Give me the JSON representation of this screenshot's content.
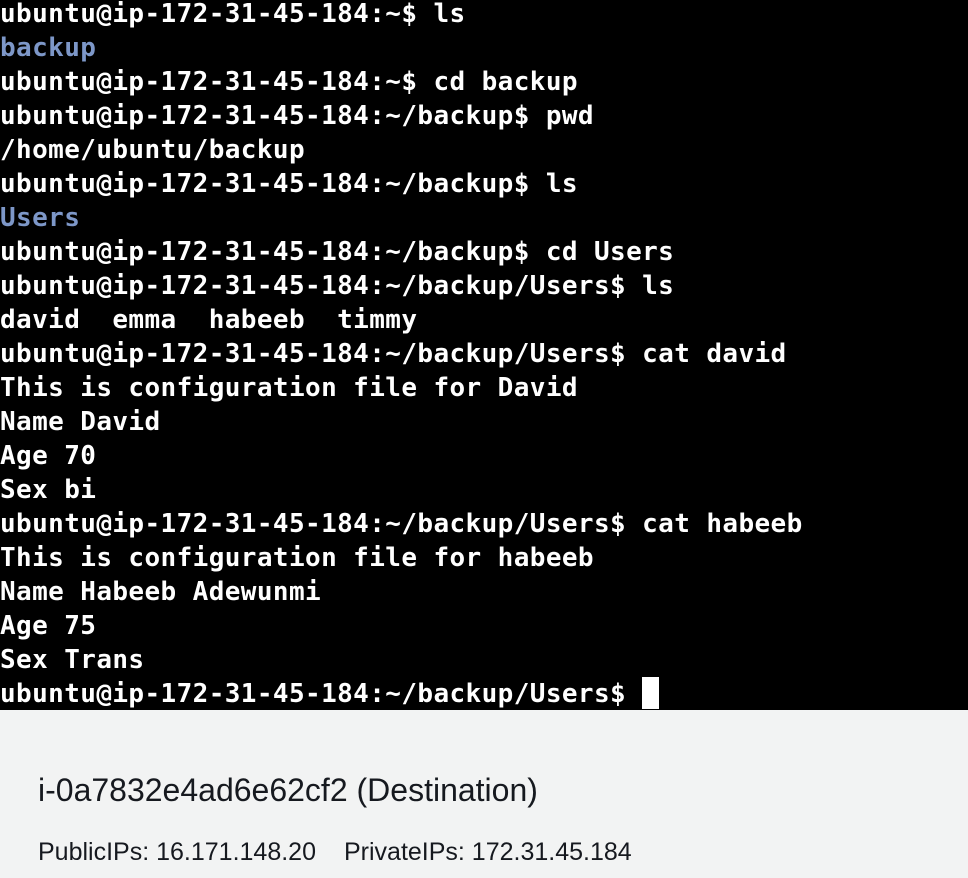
{
  "terminal": {
    "lines": [
      {
        "text": "ubuntu@ip-172-31-45-184:~$ ls",
        "kind": "prompt"
      },
      {
        "text": "backup",
        "kind": "dir"
      },
      {
        "text": "ubuntu@ip-172-31-45-184:~$ cd backup",
        "kind": "prompt"
      },
      {
        "text": "ubuntu@ip-172-31-45-184:~/backup$ pwd",
        "kind": "prompt"
      },
      {
        "text": "/home/ubuntu/backup",
        "kind": "output"
      },
      {
        "text": "ubuntu@ip-172-31-45-184:~/backup$ ls",
        "kind": "prompt"
      },
      {
        "text": "Users",
        "kind": "dir"
      },
      {
        "text": "ubuntu@ip-172-31-45-184:~/backup$ cd Users",
        "kind": "prompt"
      },
      {
        "text": "ubuntu@ip-172-31-45-184:~/backup/Users$ ls",
        "kind": "prompt"
      },
      {
        "text": "david  emma  habeeb  timmy",
        "kind": "output"
      },
      {
        "text": "ubuntu@ip-172-31-45-184:~/backup/Users$ cat david",
        "kind": "prompt"
      },
      {
        "text": "This is configuration file for David",
        "kind": "output"
      },
      {
        "text": "Name David",
        "kind": "output"
      },
      {
        "text": "Age 70",
        "kind": "output"
      },
      {
        "text": "Sex bi",
        "kind": "output"
      },
      {
        "text": "ubuntu@ip-172-31-45-184:~/backup/Users$ cat habeeb",
        "kind": "prompt"
      },
      {
        "text": "This is configuration file for habeeb",
        "kind": "output"
      },
      {
        "text": "Name Habeeb Adewunmi",
        "kind": "output"
      },
      {
        "text": "Age 75",
        "kind": "output"
      },
      {
        "text": "Sex Trans",
        "kind": "output"
      }
    ],
    "current_prompt": "ubuntu@ip-172-31-45-184:~/backup/Users$ ",
    "colors": {
      "background": "#000000",
      "text": "#ffffff",
      "directory": "#7d97c8"
    }
  },
  "instance": {
    "title": "i-0a7832e4ad6e62cf2 (Destination)",
    "public_ips": "PublicIPs: 16.171.148.20",
    "private_ips": "PrivateIPs: 172.31.45.184"
  }
}
